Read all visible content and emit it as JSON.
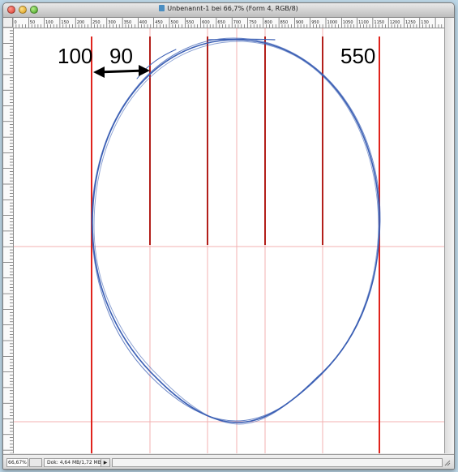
{
  "window": {
    "title": "Unbenannt-1 bei 66,7% (Form 4, RGB/8)"
  },
  "ruler": {
    "top_labels": [
      "0",
      "50",
      "100",
      "150",
      "200",
      "250",
      "300",
      "350",
      "400",
      "450",
      "500",
      "550",
      "600",
      "650",
      "700",
      "750",
      "800",
      "850",
      "900",
      "950",
      "1000",
      "1050",
      "1100",
      "1150",
      "1200",
      "1250",
      "130"
    ]
  },
  "annotations": {
    "label_left_margin": "100",
    "label_gap": "90",
    "label_right": "550"
  },
  "status": {
    "zoom": "66,67%",
    "doc_info": "Dok: 4,64 MB/1,72 MB",
    "arrow": "▶"
  },
  "colors": {
    "guide_bold": "#e0231c",
    "guide_light": "#f3b1b1",
    "outline": "#3b5fb4"
  }
}
